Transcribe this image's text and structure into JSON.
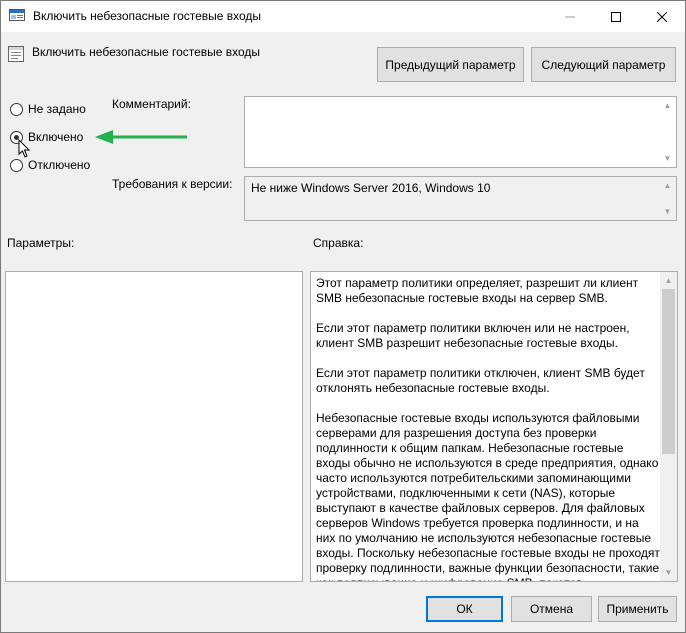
{
  "window": {
    "title": "Включить небезопасные гостевые входы"
  },
  "header": {
    "policy_name": "Включить небезопасные гостевые входы",
    "prev_button": "Предыдущий параметр",
    "next_button": "Следующий параметр"
  },
  "state": {
    "options": [
      {
        "label": "Не задано",
        "checked": false
      },
      {
        "label": "Включено",
        "checked": true
      },
      {
        "label": "Отключено",
        "checked": false
      }
    ]
  },
  "labels": {
    "comment": "Комментарий:",
    "version": "Требования к версии:",
    "parameters": "Параметры:",
    "help": "Справка:"
  },
  "comment_value": "",
  "version_value": "Не ниже Windows Server 2016, Windows 10",
  "help_paragraphs": [
    "Этот параметр политики определяет, разрешит ли клиент SMB небезопасные гостевые входы на сервер SMB.",
    "Если этот параметр политики включен или не настроен, клиент SMB разрешит небезопасные гостевые входы.",
    "Если этот параметр политики отключен, клиент SMB будет отклонять небезопасные гостевые входы.",
    "Небезопасные гостевые входы используются файловыми серверами для разрешения доступа без проверки подлинности к общим папкам. Небезопасные гостевые входы обычно не используются в среде предприятия, однако часто используются потребительскими запоминающими устройствами, подключенными к сети (NAS), которые выступают в качестве файловых серверов. Для файловых серверов Windows требуется проверка подлинности, и на них по умолчанию не используются небезопасные гостевые входы. Поскольку небезопасные гостевые входы не проходят проверку подлинности, важные функции безопасности, такие как подписывание и шифрование SMB, пакетов"
  ],
  "footer": {
    "ok": "ОК",
    "cancel": "Отмена",
    "apply": "Применить"
  },
  "colors": {
    "accent": "#0078d7",
    "arrow": "#22b14c"
  }
}
